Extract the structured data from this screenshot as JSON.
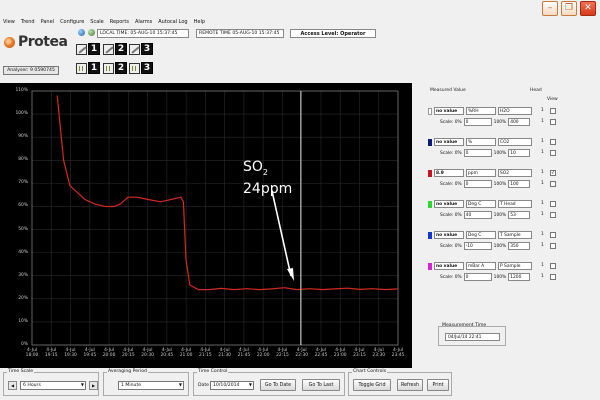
{
  "window": {
    "minimize": "–",
    "restore": "❐",
    "close": "✕"
  },
  "menu": [
    "View",
    "Trend",
    "Panel",
    "Configure",
    "Scale",
    "Reports",
    "Alarms",
    "Autocal Log",
    "Help"
  ],
  "toolbar": {
    "local_time": "LOCAL TIME: 05-AUG-10 15:37:45",
    "remote_time": "REMOTE TIME 05-AUG-10 15:37:45",
    "access": "Access Level: Operator"
  },
  "logo": "Protea",
  "layouts": {
    "n1": "1",
    "n2": "2",
    "n3": "3"
  },
  "analyser": "Analyser: 9 0590745",
  "chart_data": {
    "type": "line",
    "y_ticks": [
      "110%",
      "100%",
      "90%",
      "80%",
      "70%",
      "60%",
      "50%",
      "40%",
      "30%",
      "20%",
      "10%",
      "0%"
    ],
    "x_ticks": [
      [
        "4-Jul",
        "18:00"
      ],
      [
        "4-Jul",
        "19:15"
      ],
      [
        "4-Jul",
        "19:30"
      ],
      [
        "4-Jul",
        "19:45"
      ],
      [
        "4-Jul",
        "20:00"
      ],
      [
        "4-Jul",
        "20:15"
      ],
      [
        "4-Jul",
        "20:30"
      ],
      [
        "4-Jul",
        "20:45"
      ],
      [
        "4-Jul",
        "21:00"
      ],
      [
        "4-Jul",
        "21:15"
      ],
      [
        "4-Jul",
        "21:30"
      ],
      [
        "4-Jul",
        "21:45"
      ],
      [
        "4-Jul",
        "22:00"
      ],
      [
        "4-Jul",
        "22:15"
      ],
      [
        "4-Jul",
        "22:30"
      ],
      [
        "4-Jul",
        "22:45"
      ],
      [
        "4-Jul",
        "23:00"
      ],
      [
        "4-Jul",
        "23:15"
      ],
      [
        "4-Jul",
        "23:30"
      ],
      [
        "4-Jul",
        "23:45"
      ]
    ],
    "ylim": [
      0,
      110
    ],
    "series": [
      {
        "color": "#d42a1e",
        "points": [
          [
            2.0,
            108
          ],
          [
            2.5,
            80
          ],
          [
            3.0,
            69
          ],
          [
            3.6,
            66
          ],
          [
            4.2,
            63
          ],
          [
            5.0,
            61
          ],
          [
            5.8,
            60
          ],
          [
            6.5,
            60
          ],
          [
            7.0,
            61
          ],
          [
            7.6,
            64
          ],
          [
            8.3,
            64
          ],
          [
            9.2,
            63
          ],
          [
            10.2,
            62
          ],
          [
            11.0,
            63
          ],
          [
            11.8,
            64
          ],
          [
            12.0,
            62
          ],
          [
            12.2,
            37
          ],
          [
            12.5,
            26
          ],
          [
            13.2,
            24
          ],
          [
            14,
            24
          ],
          [
            15,
            24.5
          ],
          [
            16,
            24
          ],
          [
            17,
            24.4
          ],
          [
            18,
            24
          ],
          [
            19,
            24.3
          ],
          [
            20,
            24.8
          ],
          [
            21,
            24
          ],
          [
            22,
            24.4
          ],
          [
            23,
            24
          ],
          [
            24,
            24.3
          ],
          [
            25,
            24.6
          ],
          [
            26,
            24.1
          ],
          [
            27,
            24.4
          ],
          [
            28,
            24
          ],
          [
            29,
            24.3
          ]
        ]
      }
    ],
    "cursor_x": 21.3,
    "annotation": {
      "text_main": "SO",
      "text_sub": "2",
      "text_value": "24ppm"
    }
  },
  "panel": {
    "measured_value_label": "Measured Value",
    "head_label": "Head",
    "view_label": "View",
    "scale_label": "Scale: 0%",
    "full_label": "100%",
    "channels": [
      {
        "color": "#ffffff",
        "value": "no value",
        "unit": "%RH",
        "name": "H2O",
        "head": "1",
        "min": "0",
        "max": "400",
        "checked": ""
      },
      {
        "color": "#0a1a7a",
        "value": "no value",
        "unit": "%",
        "name": "CO2",
        "head": "1",
        "min": "0",
        "max": "10",
        "checked": ""
      },
      {
        "color": "#c8141e",
        "value": "8.9",
        "unit": "ppm",
        "name": "SO2",
        "head": "1",
        "min": "0",
        "max": "100",
        "checked": "✓"
      },
      {
        "color": "#2ed82e",
        "value": "no value",
        "unit": "Deg C",
        "name": "T Head",
        "head": "1",
        "min": "40",
        "max": "53",
        "checked": ""
      },
      {
        "color": "#1436d2",
        "value": "no value",
        "unit": "Deg C",
        "name": "T Sample",
        "head": "1",
        "min": "-10",
        "max": "350",
        "checked": ""
      },
      {
        "color": "#d424d4",
        "value": "no value",
        "unit": "mBar A",
        "name": "P Sample",
        "head": "1",
        "min": "0",
        "max": "1200",
        "checked": ""
      }
    ],
    "measurement_time_label": "Measurement Time",
    "measurement_time": "04/Jul/14  22:41"
  },
  "bottom": {
    "time_scale_label": "Time Scale",
    "time_scale": "6 Hours",
    "averaging_label": "Averaging Period",
    "averaging": "1 Minute",
    "time_control_label": "Time Control",
    "date_label": "Date",
    "date": "10/10/2014",
    "goto_date": "Go To Date",
    "goto_last": "Go To Last",
    "chart_controls_label": "Chart Controls",
    "toggle_grid": "Toggle Grid",
    "refresh": "Refresh",
    "print": "Print",
    "prev": "◀",
    "next": "▶",
    "dropdown": "▼"
  }
}
